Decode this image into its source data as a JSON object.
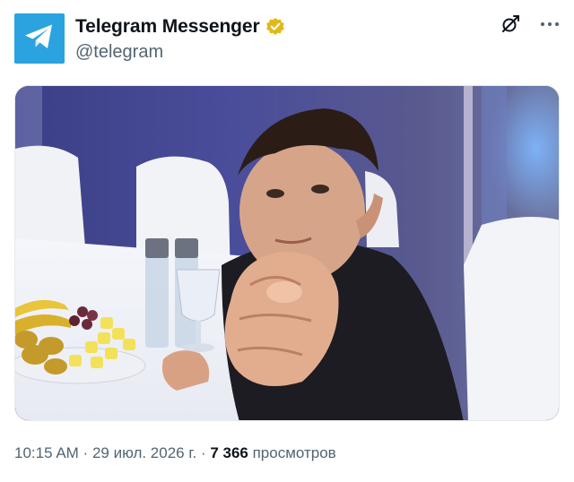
{
  "author": {
    "display_name": "Telegram Messenger",
    "handle": "@telegram",
    "avatar_icon": "telegram-plane-icon",
    "avatar_color": "#2aa3de",
    "verified_icon": "verified-badge-icon",
    "verified_color": "#e2b719"
  },
  "header_actions": {
    "grok_icon": "grok-slash-icon",
    "more_icon": "more-dots-icon"
  },
  "media": {
    "type": "photo"
  },
  "meta": {
    "time": "10:15 AM",
    "separator": " · ",
    "date": "29 июл. 2026 г.",
    "views_count": "7 366",
    "views_label": " просмотров"
  }
}
